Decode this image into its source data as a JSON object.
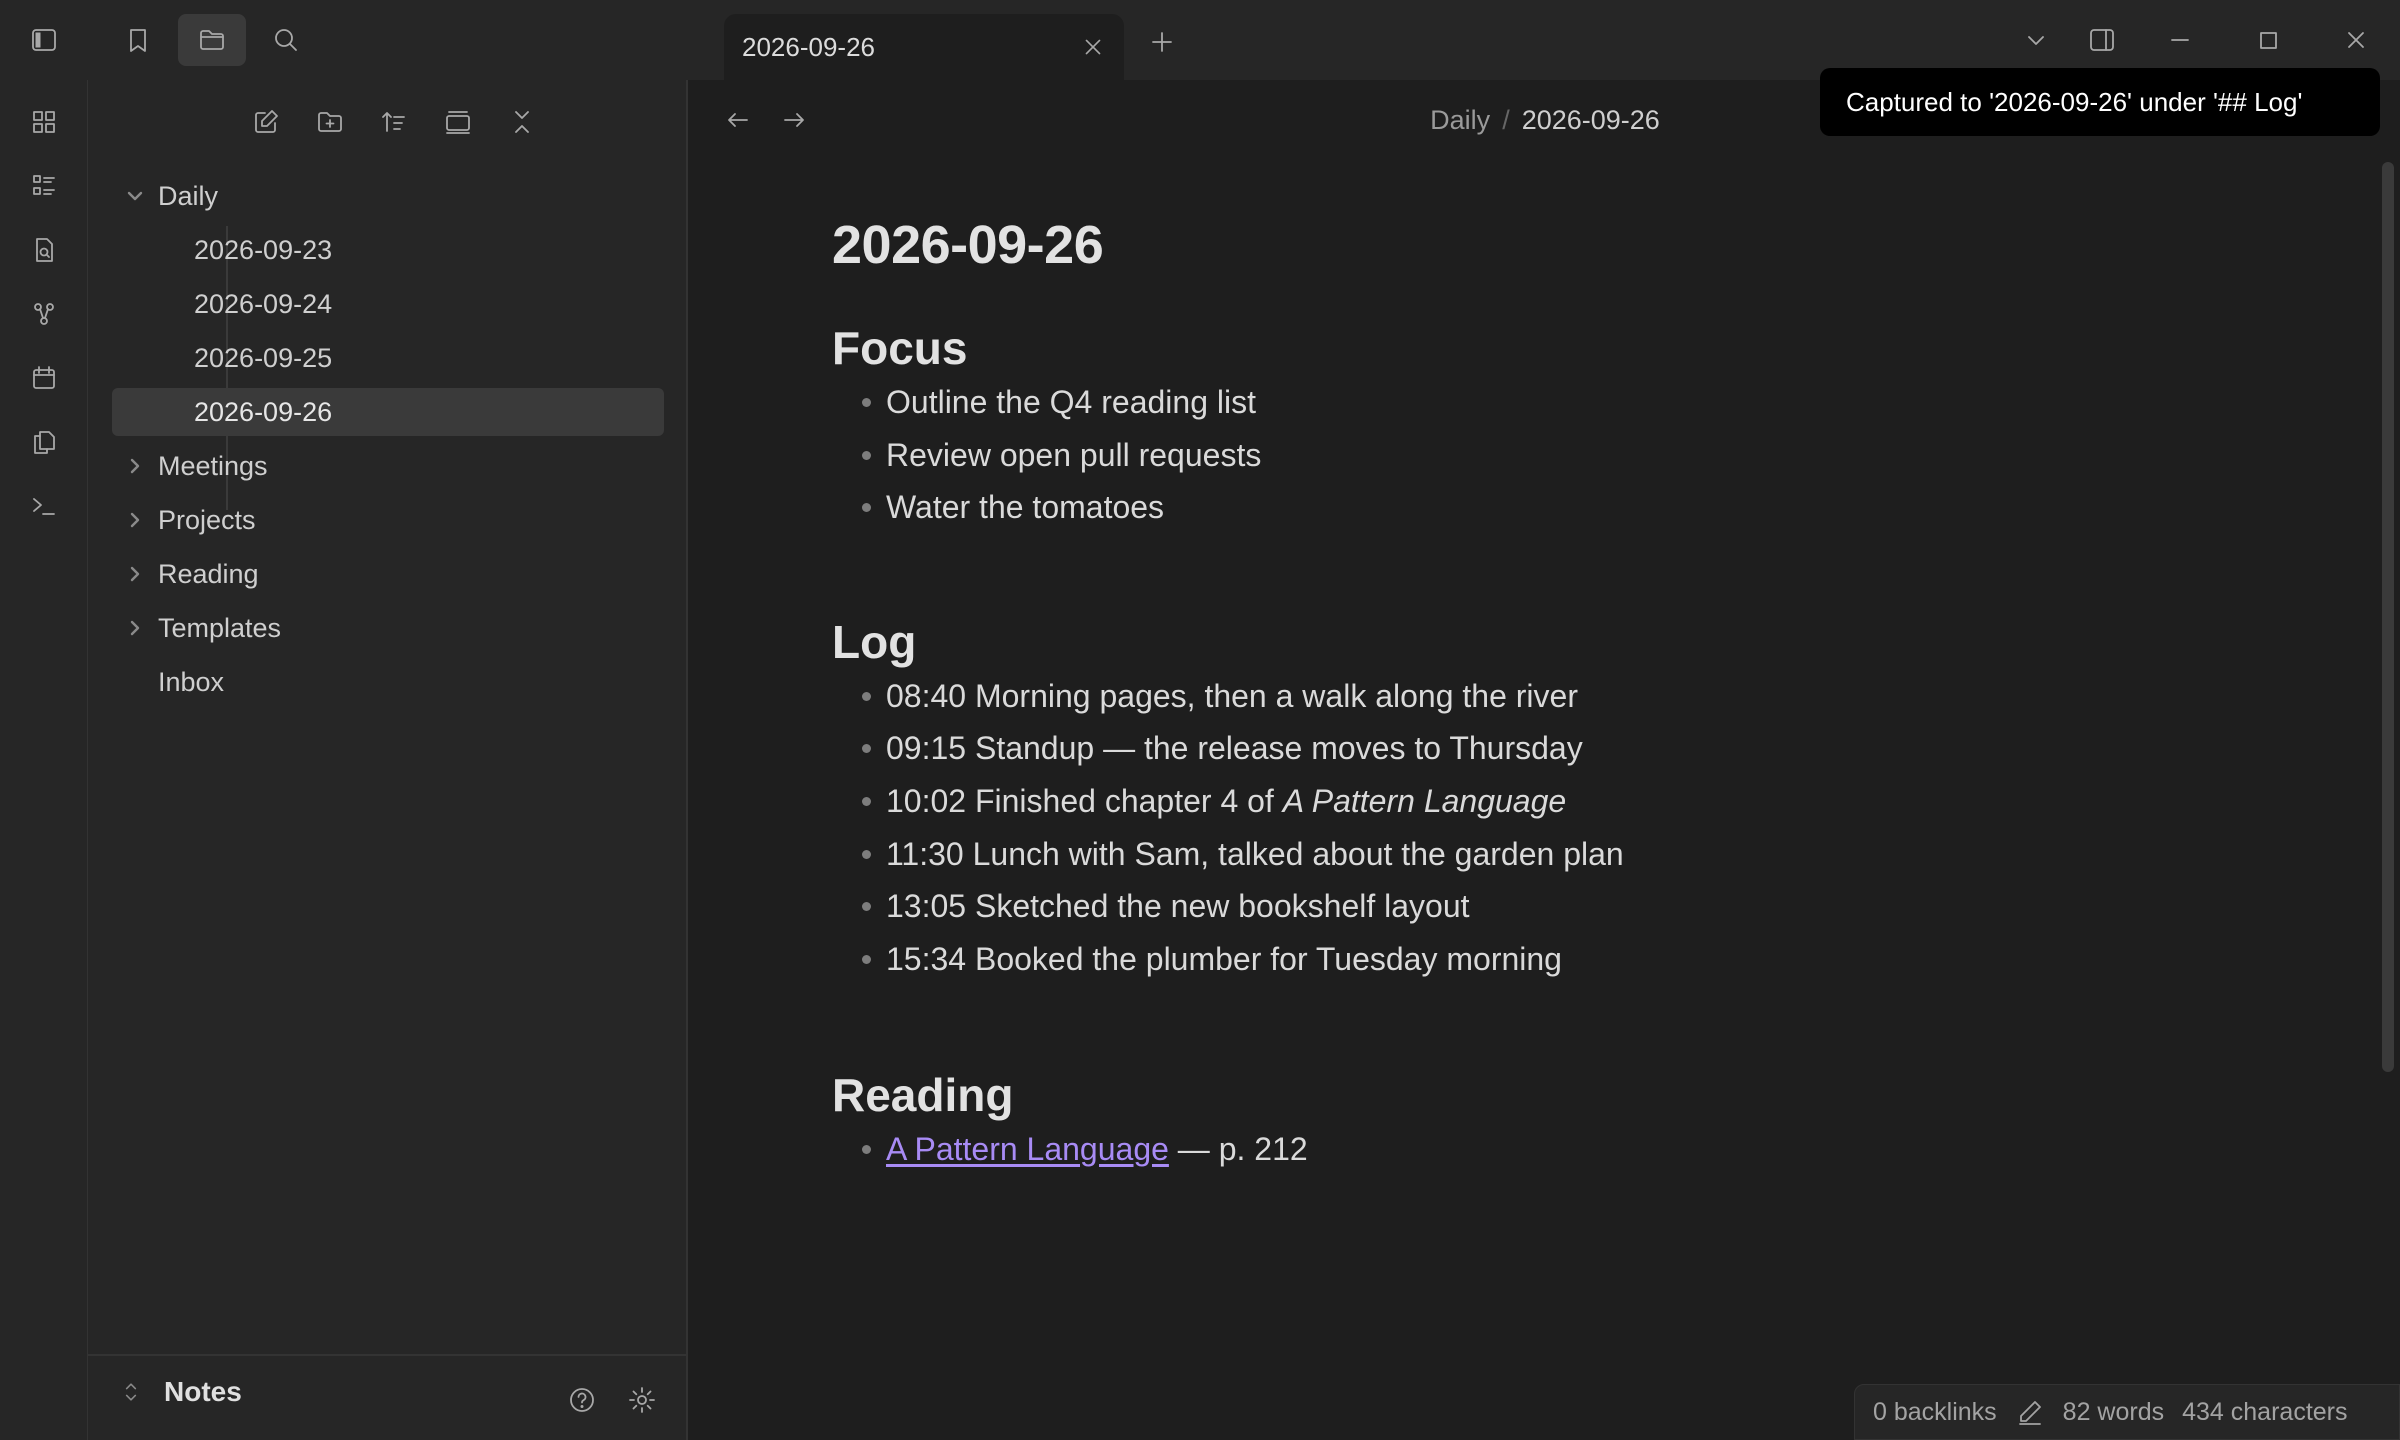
{
  "tab": {
    "title": "2026-09-26"
  },
  "breadcrumb": {
    "folder": "Daily",
    "separator": "/",
    "file": "2026-09-26"
  },
  "toast": {
    "message": "Captured to '2026-09-26' under '## Log'"
  },
  "sidebar": {
    "tree": {
      "daily": "Daily",
      "daily_children": [
        "2026-09-23",
        "2026-09-24",
        "2026-09-25",
        "2026-09-26"
      ],
      "meetings": "Meetings",
      "projects": "Projects",
      "reading": "Reading",
      "templates": "Templates",
      "inbox": "Inbox"
    },
    "vault_name": "Notes"
  },
  "note": {
    "title": "2026-09-26",
    "focus": {
      "heading": "Focus",
      "items": [
        "Outline the Q4 reading list",
        "Review open pull requests",
        "Water the tomatoes"
      ]
    },
    "log": {
      "heading": "Log",
      "items": [
        "08:40 Morning pages, then a walk along the river",
        "09:15 Standup — the release moves to Thursday",
        "10:02 Finished chapter 4 of ",
        "11:30 Lunch with Sam, talked about the garden plan",
        "13:05 Sketched the new bookshelf layout",
        "15:34 Booked the plumber for Tuesday morning"
      ],
      "item3_italic": "A Pattern Language"
    },
    "reading": {
      "heading": "Reading",
      "link_text": "A Pattern Language",
      "link_suffix": " — p. 212"
    }
  },
  "status": {
    "backlinks": "0 backlinks",
    "words": "82 words",
    "characters": "434 characters"
  },
  "colors": {
    "accent_link": "#a88bf5",
    "background": "#1e1e1e",
    "sidebar": "#262626"
  }
}
